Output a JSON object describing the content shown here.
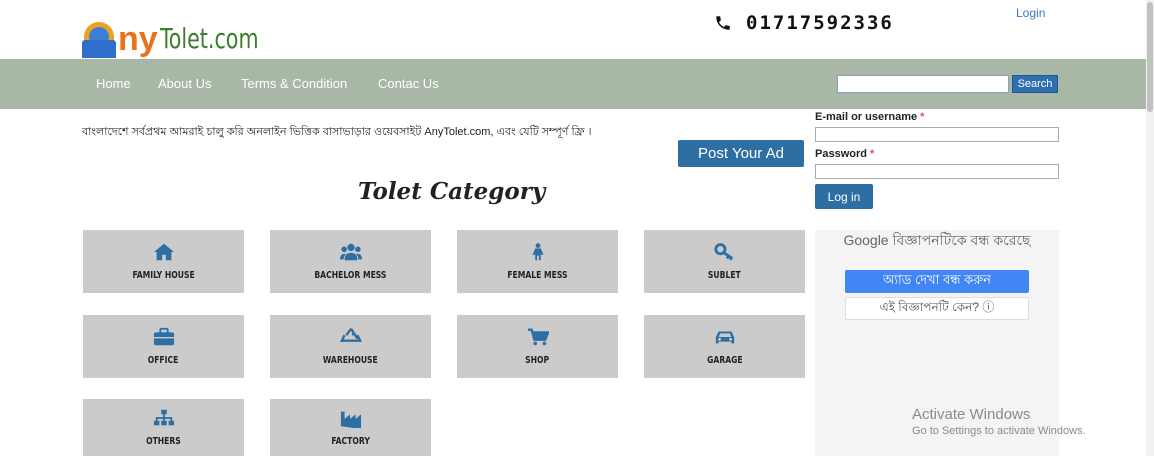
{
  "header": {
    "logo_text": "Tolet.com",
    "phone": "01717592336",
    "login_link": "Login"
  },
  "nav": {
    "items": [
      "Home",
      "About Us",
      "Terms & Condition",
      "Contac Us"
    ],
    "search_button": "Search",
    "search_value": ""
  },
  "main": {
    "notice": "বাংলাদেশে সর্বপ্রথম আমরাই চালু করি অনলাইন ভিত্তিক বাসাভাড়ার ওয়েবসাইট AnyTolet.com, এবং যেটি সম্পূর্ণ ফ্রি ।",
    "post_ad": "Post Your Ad",
    "category_title": "Tolet Category",
    "categories": [
      {
        "label": "FAMILY HOUSE",
        "icon": "home-icon"
      },
      {
        "label": "BACHELOR MESS",
        "icon": "group-icon"
      },
      {
        "label": "FEMALE MESS",
        "icon": "female-icon"
      },
      {
        "label": "SUBLET",
        "icon": "key-icon"
      },
      {
        "label": "OFFICE",
        "icon": "briefcase-icon"
      },
      {
        "label": "WAREHOUSE",
        "icon": "recycle-icon"
      },
      {
        "label": "SHOP",
        "icon": "cart-icon"
      },
      {
        "label": "GARAGE",
        "icon": "car-icon"
      },
      {
        "label": "OTHERS",
        "icon": "sitemap-icon"
      },
      {
        "label": "FACTORY",
        "icon": "industry-icon"
      }
    ]
  },
  "login_form": {
    "username_label": "E-mail or username",
    "password_label": "Password",
    "required_mark": "*",
    "username_value": "",
    "password_value": "",
    "submit": "Log in"
  },
  "ad": {
    "google_text": "Google বিজ্ঞাপনটিকে বন্ধ করেছে",
    "stop_button": "অ্যাড দেখা বন্ধ করুন",
    "why_button": "এই বিজ্ঞাপনটি কেন? ⓘ"
  },
  "os_watermark": {
    "line1": "Activate Windows",
    "line2": "Go to Settings to activate Windows."
  },
  "colors": {
    "navbar": "#a9b8a6",
    "accent": "#2d6ea3",
    "card": "#cbcbcb",
    "icon": "#2d6ea3"
  }
}
